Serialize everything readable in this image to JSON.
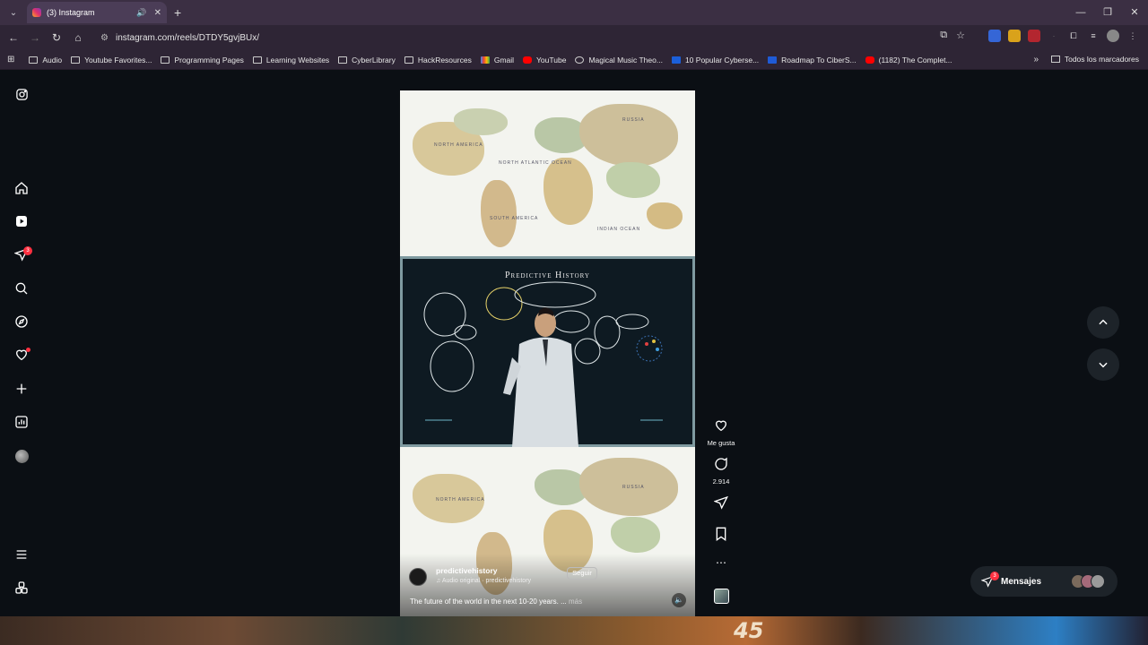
{
  "browser": {
    "tab_title": "(3) Instagram",
    "url": "instagram.com/reels/DTDY5gvjBUx/",
    "bookmarks": [
      {
        "label": "Audio",
        "icon": "folder-icon"
      },
      {
        "label": "Youtube Favorites...",
        "icon": "folder-icon"
      },
      {
        "label": "Programming Pages",
        "icon": "folder-icon"
      },
      {
        "label": "Learning Websites",
        "icon": "folder-icon"
      },
      {
        "label": "CyberLibrary",
        "icon": "folder-icon"
      },
      {
        "label": "HackResources",
        "icon": "folder-icon"
      },
      {
        "label": "Gmail",
        "icon": "gmail-icon"
      },
      {
        "label": "YouTube",
        "icon": "youtube-icon"
      },
      {
        "label": "Magical Music Theo...",
        "icon": "music-icon"
      },
      {
        "label": "10 Popular Cyberse...",
        "icon": "c-icon"
      },
      {
        "label": "Roadmap To CiberS...",
        "icon": "trello-icon"
      },
      {
        "label": "(1182) The Complet...",
        "icon": "youtube-icon"
      }
    ],
    "all_bookmarks": "Todos los marcadores"
  },
  "sidebar": {
    "notifications_badge": "3"
  },
  "reel": {
    "board_title": "Predictive History",
    "username": "predictivehistory",
    "audio": "Audio original · predictivehistory",
    "follow": "Seguir",
    "caption": "The future of the world in the next 10-20 years. ...",
    "more": "más"
  },
  "actions": {
    "like_label": "Me gusta",
    "comments_count": "2.914"
  },
  "messages": {
    "label": "Mensajes",
    "badge": "3"
  },
  "colors": {
    "accent_badge": "#ff3040",
    "background": "#0b0f14",
    "chrome_frame": "#2e2535"
  }
}
